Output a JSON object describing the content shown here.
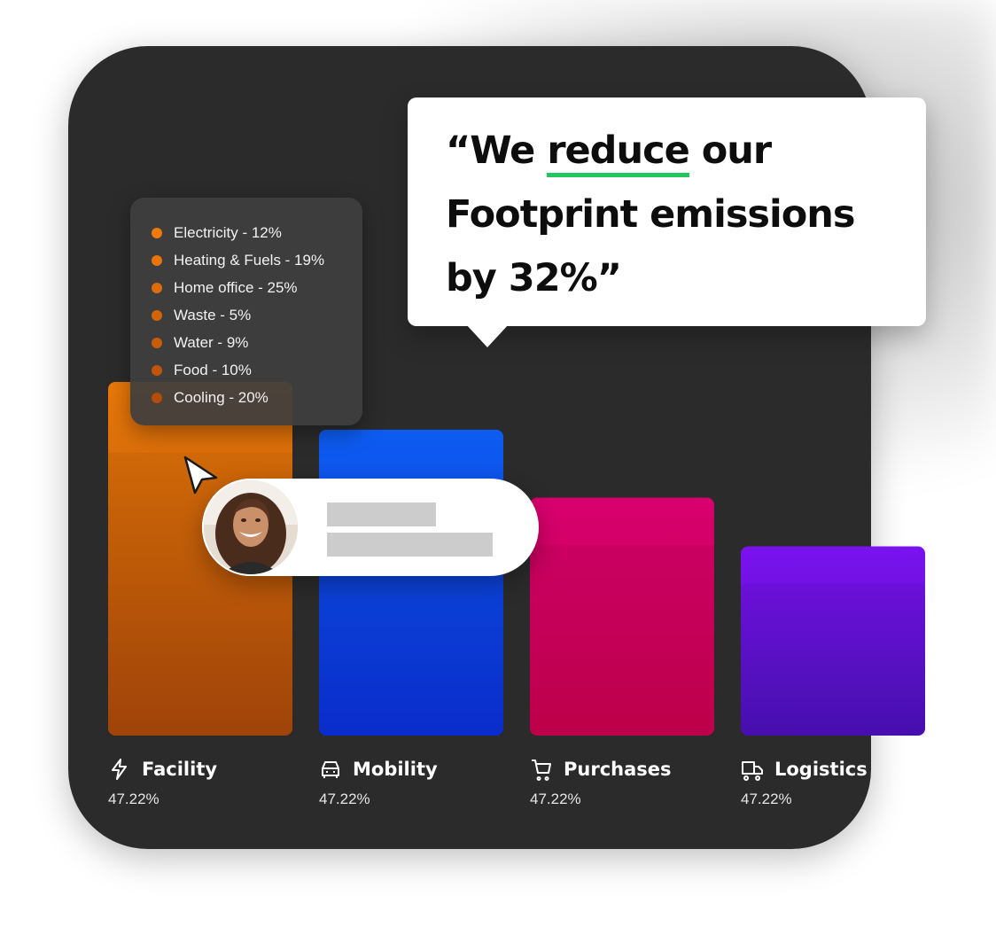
{
  "quote": {
    "open_mark": "“",
    "word_before": "We",
    "highlight": "reduce",
    "rest_line1": "our",
    "line2": "Footprint emissions",
    "line3": "by 32%”",
    "highlight_color": "#22c55e"
  },
  "legend": {
    "items": [
      {
        "label": "Electricity - 12%",
        "color": "#ef7a0a"
      },
      {
        "label": "Heating & Fuels - 19%",
        "color": "#e8740a"
      },
      {
        "label": "Home office - 25%",
        "color": "#de6c0a"
      },
      {
        "label": "Waste - 5%",
        "color": "#d4640a"
      },
      {
        "label": "Water - 9%",
        "color": "#c95c0a"
      },
      {
        "label": "Food - 10%",
        "color": "#bf540a"
      },
      {
        "label": "Cooling - 20%",
        "color": "#b44c0a"
      }
    ]
  },
  "user_card": {
    "avatar": "woman-smiling-avatar"
  },
  "chart_data": {
    "type": "bar",
    "categories": [
      "Facility",
      "Mobility",
      "Purchases",
      "Logistics"
    ],
    "value_labels": [
      "47.22%",
      "47.22%",
      "47.22%",
      "47.22%"
    ],
    "relative_heights": [
      1.0,
      0.865,
      0.673,
      0.535
    ],
    "icons": [
      "lightning-icon",
      "car-icon",
      "cart-icon",
      "truck-icon"
    ],
    "colors": [
      {
        "top": "#e87809",
        "bottom": "#a8470a"
      },
      {
        "top": "#0d5cf0",
        "bottom": "#0b2fd6"
      },
      {
        "top": "#d8006e",
        "bottom": "#c8004e"
      },
      {
        "top": "#7b12f0",
        "bottom": "#4a10b8"
      }
    ]
  }
}
